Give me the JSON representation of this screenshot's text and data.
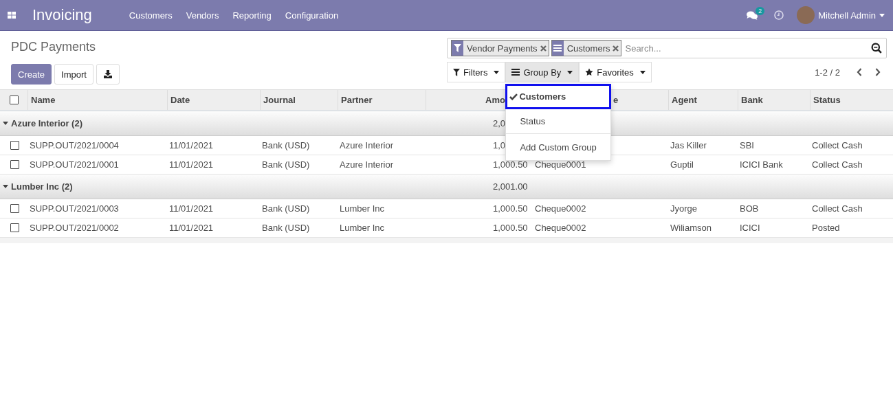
{
  "navbar": {
    "app_name": "Invoicing",
    "menu": [
      "Customers",
      "Vendors",
      "Reporting",
      "Configuration"
    ],
    "messages_badge": "2",
    "user": "Mitchell Admin"
  },
  "breadcrumb": "PDC Payments",
  "buttons": {
    "create": "Create",
    "import": "Import"
  },
  "search": {
    "facets": [
      {
        "kind": "filter",
        "label": "Vendor Payments"
      },
      {
        "kind": "groupby",
        "label": "Customers"
      }
    ],
    "placeholder": "Search..."
  },
  "search_options": [
    {
      "kind": "filter",
      "label": "Filters",
      "open": false
    },
    {
      "kind": "groupby",
      "label": "Group By",
      "open": true
    },
    {
      "kind": "favorites",
      "label": "Favorites",
      "open": false
    }
  ],
  "pager": "1-2 / 2",
  "group_by_menu": [
    {
      "kind": "option",
      "label": "Customers",
      "selected": true
    },
    {
      "kind": "option",
      "label": "Status",
      "selected": false
    },
    {
      "kind": "custom",
      "label": "Add Custom Group"
    }
  ],
  "table": {
    "select_all_checked": false,
    "columns": {
      "name": "Name",
      "date": "Date",
      "journal": "Journal",
      "partner": "Partner",
      "amount": "Amo",
      "column_6": "e",
      "agent": "Agent",
      "bank": "Bank",
      "status": "Status"
    },
    "groups": [
      {
        "title": "Azure Interior (2)",
        "total": "2,0",
        "expanded": true,
        "rows": [
          {
            "checked": false,
            "name": "SUPP.OUT/2021/0004",
            "date": "11/01/2021",
            "journal": "Bank (USD)",
            "partner": "Azure Interior",
            "amount": "1,0",
            "agent": "Jas Killer",
            "bank": "SBI",
            "status": "Collect Cash"
          },
          {
            "checked": false,
            "name": "SUPP.OUT/2021/0001",
            "date": "11/01/2021",
            "journal": "Bank (USD)",
            "partner": "Azure Interior",
            "amount": "1,000.50",
            "cheque": "Cheque0001",
            "agent": "Guptil",
            "bank": "ICICI Bank",
            "status": "Collect Cash"
          }
        ]
      },
      {
        "title": "Lumber Inc (2)",
        "total": "2,001.00",
        "expanded": true,
        "rows": [
          {
            "checked": false,
            "name": "SUPP.OUT/2021/0003",
            "date": "11/01/2021",
            "journal": "Bank (USD)",
            "partner": "Lumber Inc",
            "amount": "1,000.50",
            "cheque": "Cheque0002",
            "agent": "Jyorge",
            "bank": "BOB",
            "status": "Collect Cash"
          },
          {
            "checked": false,
            "name": "SUPP.OUT/2021/0002",
            "date": "11/01/2021",
            "journal": "Bank (USD)",
            "partner": "Lumber Inc",
            "amount": "1,000.50",
            "cheque": "Cheque0002",
            "agent": "Wiliamson",
            "bank": "ICICI",
            "status": "Posted"
          }
        ]
      }
    ]
  }
}
